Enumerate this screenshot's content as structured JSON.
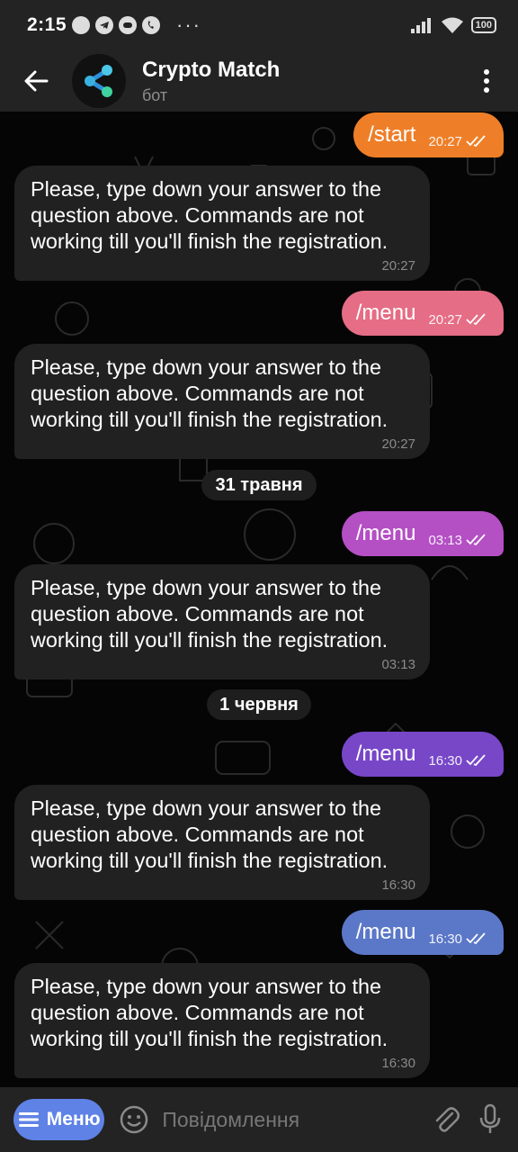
{
  "status_bar": {
    "time": "2:15",
    "battery": "100"
  },
  "header": {
    "title": "Crypto Match",
    "subtitle": "бот"
  },
  "messages": [
    {
      "type": "out",
      "text": "/start",
      "time": "20:27",
      "color": "#ee7f28"
    },
    {
      "type": "in",
      "text": "Please, type down your answer to the question above. Commands are not working till you'll finish the registration.",
      "time": "20:27"
    },
    {
      "type": "out",
      "text": "/menu",
      "time": "20:27",
      "color": "#e56d85"
    },
    {
      "type": "in",
      "text": "Please, type down your answer to the question above. Commands are not working till you'll finish the registration.",
      "time": "20:27"
    },
    {
      "type": "date",
      "text": "31 травня"
    },
    {
      "type": "out",
      "text": "/menu",
      "time": "03:13",
      "color": "#b44fc4"
    },
    {
      "type": "in",
      "text": "Please, type down your answer to the question above. Commands are not working till you'll finish the registration.",
      "time": "03:13"
    },
    {
      "type": "date",
      "text": "1 червня"
    },
    {
      "type": "out",
      "text": "/menu",
      "time": "16:30",
      "color": "#7747c8"
    },
    {
      "type": "in",
      "text": "Please, type down your answer to the question above. Commands are not working till you'll finish the registration.",
      "time": "16:30"
    },
    {
      "type": "out",
      "text": "/menu",
      "time": "16:30",
      "color": "#5b77c8"
    },
    {
      "type": "in",
      "text": "Please, type down your answer to the question above. Commands are not working till you'll finish the registration.",
      "time": "16:30"
    }
  ],
  "bottom_bar": {
    "menu_label": "Меню",
    "input_placeholder": "Повідомлення"
  },
  "colors": {
    "header_bg": "#232323",
    "incoming_bubble": "#212121",
    "menu_button": "#5f82e6"
  }
}
